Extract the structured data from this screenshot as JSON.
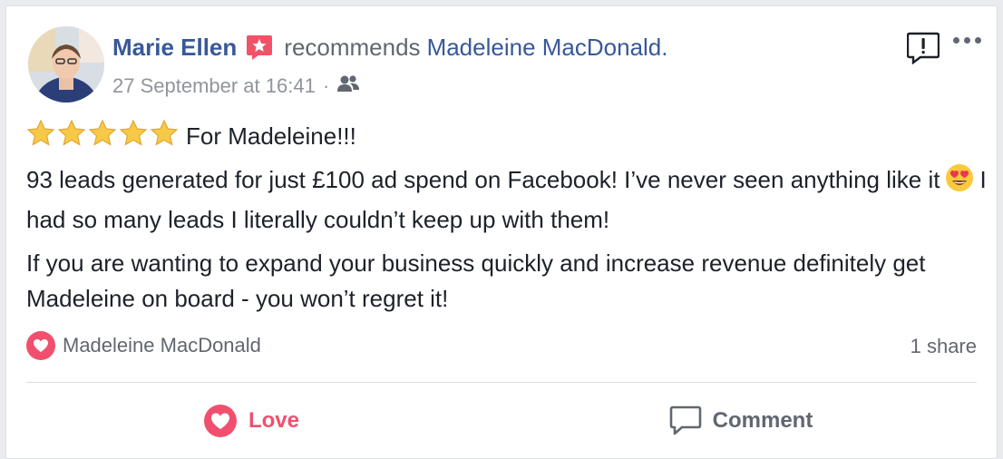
{
  "post": {
    "author": "Marie Ellen",
    "verb": "recommends",
    "target": "Madeleine MacDonald.",
    "timestamp": "27 September at 16:41",
    "meta_sep": "·",
    "paragraphs": {
      "p1_text": "For Madeleine!!!",
      "p2_part1": "93 leads generated for just £100 ad spend on Facebook! I’ve never seen anything like it",
      "p2_part2": "I had so many leads I literally couldn’t keep up with them!",
      "p3_text": "If you are wanting to expand your business quickly and increase revenue definitely get Madeleine on board - you won’t regret it!"
    },
    "star_count": 5
  },
  "reactions": {
    "name": "Madeleine MacDonald",
    "shares": "1 share"
  },
  "actions": {
    "love_label": "Love",
    "comment_label": "Comment"
  },
  "icons": {
    "badge": "recommendation-star-icon",
    "audience": "friends-icon",
    "report": "report-icon",
    "more": "more-icon",
    "stars": "star-icon",
    "emoji": "heart-eyes-emoji-icon",
    "love": "heart-icon",
    "comment": "comment-icon"
  },
  "colors": {
    "link": "#385898",
    "love": "#f0506e",
    "secondary": "#616770",
    "meta": "#90949c",
    "text": "#1d2129",
    "badge": "#f25268",
    "star": "#f7c948"
  }
}
